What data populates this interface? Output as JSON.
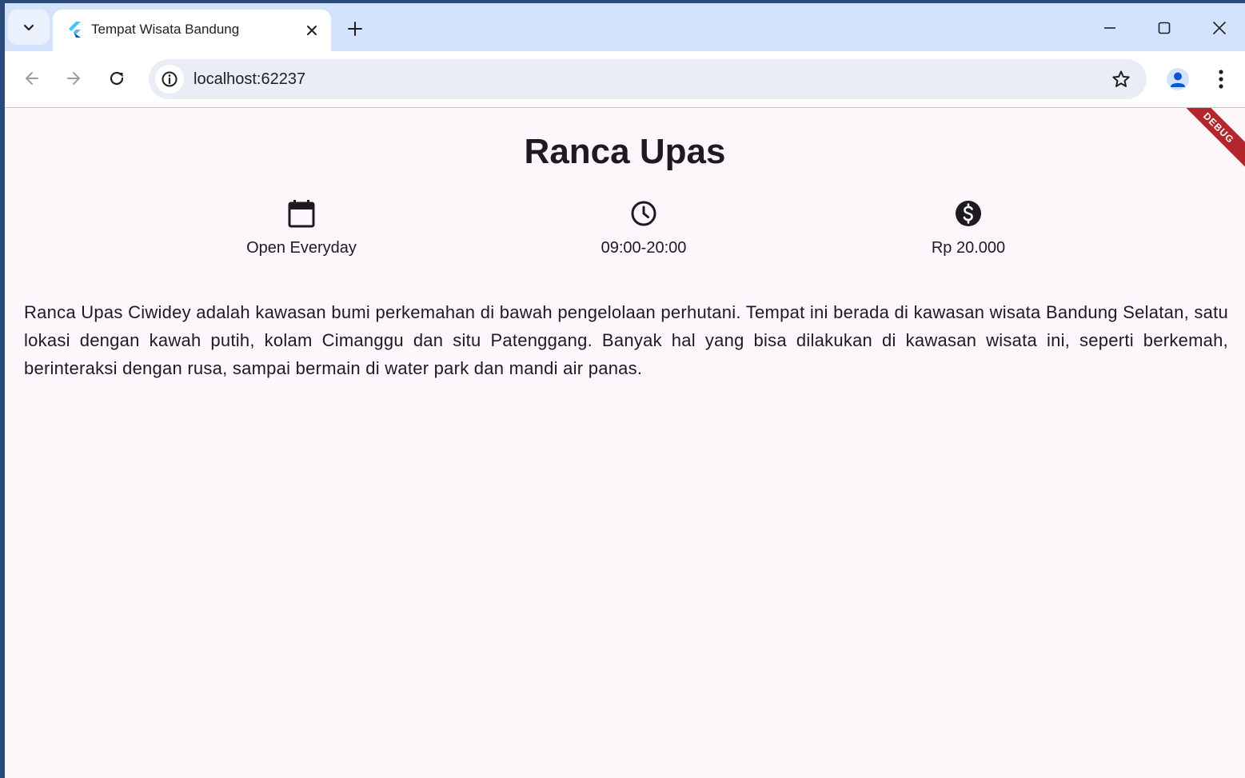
{
  "browser": {
    "tab_title": "Tempat Wisata Bandung",
    "url": "localhost:62237"
  },
  "page": {
    "title": "Ranca Upas",
    "info": {
      "days": "Open Everyday",
      "hours": "09:00-20:00",
      "price": "Rp 20.000"
    },
    "description": "Ranca Upas Ciwidey adalah kawasan bumi perkemahan di bawah pengelolaan perhutani. Tempat ini berada di kawasan wisata Bandung Selatan, satu lokasi dengan kawah putih, kolam Cimanggu dan situ Patenggang. Banyak hal yang bisa dilakukan di kawasan wisata ini, seperti berkemah, berinteraksi dengan rusa, sampai bermain di water park dan mandi air panas.",
    "debug_banner": "DEBUG"
  },
  "icons": {
    "tab_search": "chevron-down-icon",
    "favicon": "flutter-logo-icon",
    "tab_close": "close-icon",
    "new_tab": "plus-icon",
    "minimize": "minimize-icon",
    "maximize": "maximize-icon",
    "close_window": "close-icon",
    "back": "arrow-left-icon",
    "forward": "arrow-right-icon",
    "reload": "reload-icon",
    "site_info": "info-icon",
    "bookmark": "star-icon",
    "profile": "person-icon",
    "menu": "kebab-menu-icon",
    "calendar": "calendar-icon",
    "clock": "clock-icon",
    "price": "dollar-icon"
  },
  "colors": {
    "tabstrip": "#d3e3fd",
    "page_background": "#fdf7fc",
    "text": "#1d1b20",
    "debug_banner": "#b3262e",
    "profile_accent": "#0b57d0"
  }
}
